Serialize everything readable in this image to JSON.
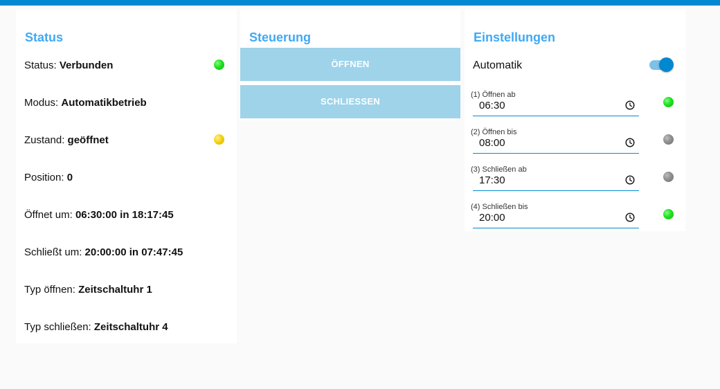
{
  "status": {
    "title": "Status",
    "rows": [
      {
        "label": "Status: ",
        "value": "Verbunden",
        "indicator": "#21e021"
      },
      {
        "label": "Modus: ",
        "value": "Automatikbetrieb"
      },
      {
        "label": "Zustand: ",
        "value": "geöffnet",
        "indicator": "#f5d212"
      },
      {
        "label": "Position: ",
        "value": "0"
      },
      {
        "label": "Öffnet um: ",
        "value": "06:30:00 in 18:17:45"
      },
      {
        "label": "Schließt um: ",
        "value": "20:00:00 in 07:47:45"
      },
      {
        "label": "Typ öffnen: ",
        "value": "Zeitschaltuhr 1"
      },
      {
        "label": "Typ schließen: ",
        "value": "Zeitschaltuhr 4"
      }
    ]
  },
  "control": {
    "title": "Steuerung",
    "open_label": "ÖFFNEN",
    "close_label": "SCHLIESSEN"
  },
  "settings": {
    "title": "Einstellungen",
    "automatik_label": "Automatik",
    "automatik_on": true,
    "timers": [
      {
        "label": "(1) Öffnen ab",
        "value": "06:30",
        "indicator": "green"
      },
      {
        "label": "(2) Öffnen bis",
        "value": "08:00",
        "indicator": "grey"
      },
      {
        "label": "(3) Schließen ab",
        "value": "17:30",
        "indicator": "grey"
      },
      {
        "label": "(4) Schließen bis",
        "value": "20:00",
        "indicator": "green"
      }
    ]
  },
  "colors": {
    "accent": "#0288d1",
    "title": "#3fa9f5",
    "button": "#9ed3ea",
    "background": "#fafafa",
    "led_green": "#21e021",
    "led_yellow": "#f5d212",
    "led_grey": "#8f8f8f"
  },
  "icons": {
    "clock": "clock-icon"
  }
}
